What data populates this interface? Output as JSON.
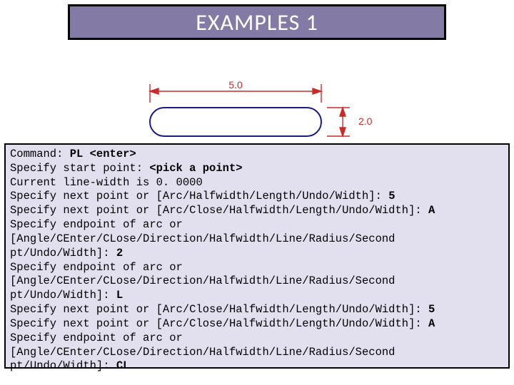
{
  "title": "EXAMPLES 1",
  "dimensions": {
    "width_label": "5.0",
    "height_label": "2.0"
  },
  "command_lines": [
    {
      "segments": [
        {
          "t": "Command: "
        },
        {
          "t": "PL <enter>",
          "b": true
        }
      ]
    },
    {
      "segments": [
        {
          "t": "Specify start point: "
        },
        {
          "t": "<pick a point>",
          "b": true
        }
      ]
    },
    {
      "segments": [
        {
          "t": "Current line-width is 0. 0000"
        }
      ]
    },
    {
      "segments": [
        {
          "t": "Specify next point or [Arc/Halfwidth/Length/Undo/Width]: "
        },
        {
          "t": "5",
          "b": true
        }
      ]
    },
    {
      "segments": [
        {
          "t": "Specify next point or [Arc/Close/Halfwidth/Length/Undo/Width]: "
        },
        {
          "t": "A",
          "b": true
        }
      ]
    },
    {
      "segments": [
        {
          "t": "Specify endpoint of arc or"
        }
      ]
    },
    {
      "segments": [
        {
          "t": "[Angle/CEnter/CLose/Direction/Halfwidth/Line/Radius/Second"
        }
      ]
    },
    {
      "segments": [
        {
          "t": "pt/Undo/Width]: "
        },
        {
          "t": "2",
          "b": true
        }
      ]
    },
    {
      "segments": [
        {
          "t": "Specify endpoint of arc or"
        }
      ]
    },
    {
      "segments": [
        {
          "t": "[Angle/CEnter/CLose/Direction/Halfwidth/Line/Radius/Second"
        }
      ]
    },
    {
      "segments": [
        {
          "t": "pt/Undo/Width]: "
        },
        {
          "t": "L",
          "b": true
        }
      ]
    },
    {
      "segments": [
        {
          "t": "Specify next point or [Arc/Close/Halfwidth/Length/Undo/Width]: "
        },
        {
          "t": "5",
          "b": true
        }
      ]
    },
    {
      "segments": [
        {
          "t": "Specify next point or [Arc/Close/Halfwidth/Length/Undo/Width]: "
        },
        {
          "t": "A",
          "b": true
        }
      ]
    },
    {
      "segments": [
        {
          "t": "Specify endpoint of arc or"
        }
      ]
    },
    {
      "segments": [
        {
          "t": "[Angle/CEnter/CLose/Direction/Halfwidth/Line/Radius/Second"
        }
      ]
    },
    {
      "segments": [
        {
          "t": "pt/Undo/Width]: "
        },
        {
          "t": "CL",
          "b": true
        }
      ]
    }
  ]
}
